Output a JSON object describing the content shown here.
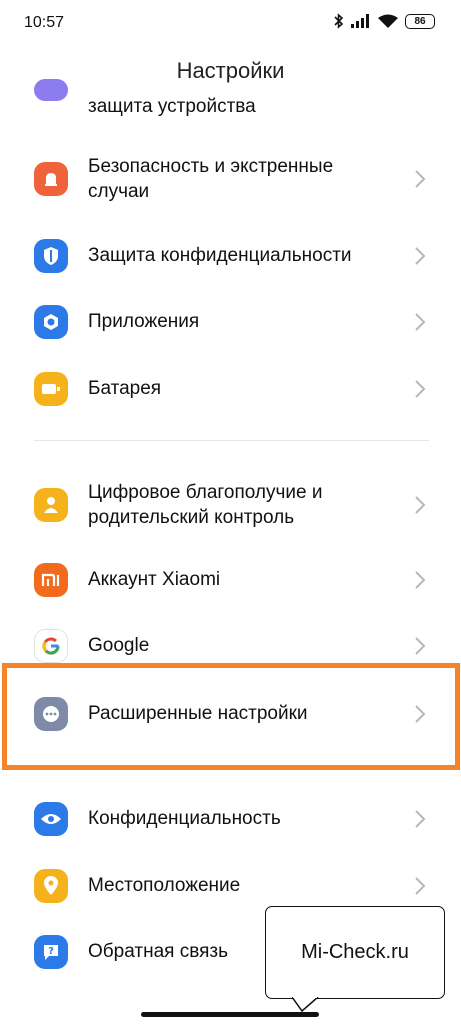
{
  "status_bar": {
    "time": "10:57",
    "battery": "86"
  },
  "header": {
    "title": "Настройки"
  },
  "items": [
    {
      "label": "защита устройства",
      "color": "#8c7cf0"
    },
    {
      "label": "Безопасность и экстренные\nслучаи",
      "icon": "alert-icon",
      "color": "#f0623a"
    },
    {
      "label": "Защита конфиденциальности",
      "icon": "shield-icon",
      "color": "#2c7ae8"
    },
    {
      "label": "Приложения",
      "icon": "apps-icon",
      "color": "#2c7ae8"
    },
    {
      "label": "Батарея",
      "icon": "battery-icon",
      "color": "#f5b21a"
    },
    {
      "label": "Цифровое благополучие и\nродительский контроль",
      "icon": "wellbeing-icon",
      "color": "#f5b21a"
    },
    {
      "label": "Аккаунт Xiaomi",
      "icon": "mi-icon",
      "color": "#f26b1d"
    },
    {
      "label": "Google",
      "icon": "google-icon",
      "color": "#ffffff"
    },
    {
      "label": "Расширенные настройки",
      "icon": "more-icon",
      "color": "#7e8aa8"
    },
    {
      "label": "Конфиденциальность",
      "icon": "eye-icon",
      "color": "#2c7ae8"
    },
    {
      "label": "Местоположение",
      "icon": "location-icon",
      "color": "#f5b21a"
    },
    {
      "label": "Обратная связь",
      "icon": "feedback-icon",
      "color": "#2c7ae8"
    }
  ],
  "watermark": {
    "text": "Mi-Check.ru"
  }
}
